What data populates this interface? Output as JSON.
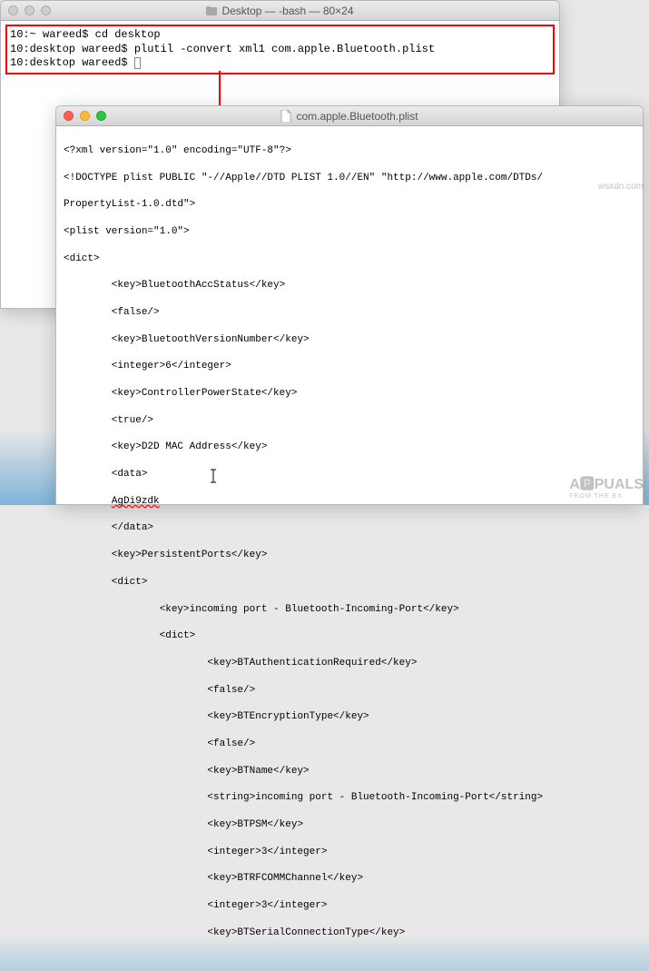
{
  "terminal": {
    "title": "Desktop — -bash — 80×24",
    "lines": {
      "l1": "10:~ wareed$ cd desktop",
      "l2": "10:desktop wareed$ plutil -convert xml1 com.apple.Bluetooth.plist",
      "l3": "10:desktop wareed$ "
    }
  },
  "editor": {
    "title": "com.apple.Bluetooth.plist",
    "content": {
      "l1": "<?xml version=\"1.0\" encoding=\"UTF-8\"?>",
      "l2": "<!DOCTYPE plist PUBLIC \"-//Apple//DTD PLIST 1.0//EN\" \"http://www.apple.com/DTDs/",
      "l3": "PropertyList-1.0.dtd\">",
      "l4": "<plist version=\"1.0\">",
      "l5": "<dict>",
      "l6": "        <key>BluetoothAccStatus</key>",
      "l7": "        <false/>",
      "l8": "        <key>BluetoothVersionNumber</key>",
      "l9": "        <integer>6</integer>",
      "l10": "        <key>ControllerPowerState</key>",
      "l11": "        <true/>",
      "l12": "        <key>D2D MAC Address</key>",
      "l13": "        <data>",
      "l14_pre": "        ",
      "l14_squiggle": "AgDi9zdk",
      "l15": "        </data>",
      "l16": "        <key>PersistentPorts</key>",
      "l17": "        <dict>",
      "l18": "                <key>incoming port - Bluetooth-Incoming-Port</key>",
      "l19": "                <dict>",
      "l20": "                        <key>BTAuthenticationRequired</key>",
      "l21": "                        <false/>",
      "l22": "                        <key>BTEncryptionType</key>",
      "l23": "                        <false/>",
      "l24": "                        <key>BTName</key>",
      "l25": "                        <string>incoming port - Bluetooth-Incoming-Port</string>",
      "l26": "                        <key>BTPSM</key>",
      "l27": "                        <integer>3</integer>",
      "l28": "                        <key>BTRFCOMMChannel</key>",
      "l29": "                        <integer>3</integer>",
      "l30": "                        <key>BTSerialConnectionType</key>"
    }
  },
  "watermark": {
    "main": "A🅿PUALS",
    "sub": "FROM THE EX"
  },
  "attribution": "wsxdn.com"
}
